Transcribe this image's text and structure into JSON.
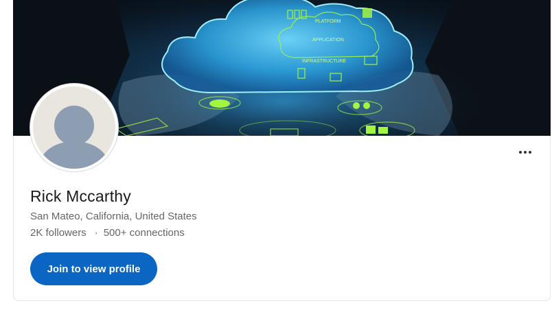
{
  "profile": {
    "name": "Rick Mccarthy",
    "location": "San Mateo, California, United States",
    "followers": "2K followers",
    "separator": "·",
    "connections": "500+ connections"
  },
  "actions": {
    "join_label": "Join to view profile",
    "more_icon": "more-horizontal-icon"
  },
  "banner": {
    "cloud_labels": {
      "platform": "PLATFORM",
      "application": "APPLICATION",
      "infrastructure": "INFRASTRUCTURE"
    }
  },
  "colors": {
    "accent": "#0a66c2",
    "name_text": "#1a1a1a",
    "secondary_text": "#666666",
    "avatar_bg": "#e9e5df",
    "avatar_fg": "#8e9eb2",
    "cloud_glow": "#48c8f5",
    "banner_green": "#a4f542"
  }
}
